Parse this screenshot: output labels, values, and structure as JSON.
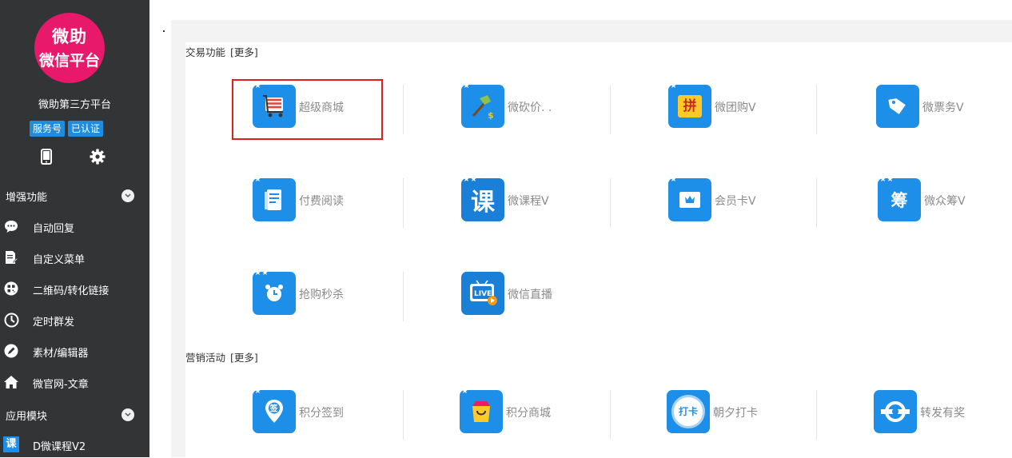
{
  "sidebar": {
    "logo": {
      "line1": "微助",
      "line2": "微信平台"
    },
    "account_name": "微助第三方平台",
    "badges": [
      "服务号",
      "已认证"
    ],
    "tool_icons": [
      "phone-icon",
      "gear-icon"
    ],
    "groups": [
      {
        "title": "增强功能"
      },
      {
        "title": "应用模块"
      }
    ],
    "items": [
      {
        "label": "自动回复",
        "icon": "chat-bubble-icon"
      },
      {
        "label": "自定义菜单",
        "icon": "document-edit-icon"
      },
      {
        "label": "二维码/转化链接",
        "icon": "qrcode-icon"
      },
      {
        "label": "定时群发",
        "icon": "clock-icon"
      },
      {
        "label": "素材/编辑器",
        "icon": "pencil-icon"
      },
      {
        "label": "微官网-文章",
        "icon": "home-icon"
      },
      {
        "label": "D微课程V2",
        "icon": "course-icon"
      }
    ],
    "colors": {
      "background": "#333436",
      "logo": "#e8186a",
      "badge": "#1e8de0"
    }
  },
  "sections": [
    {
      "title": "交易功能",
      "more": "[更多]",
      "tiles": [
        {
          "label": "超级商城",
          "icon": "shopping-cart-icon",
          "selected": true
        },
        {
          "label": "微砍价. .",
          "icon": "bargain-axe-icon"
        },
        {
          "label": "微团购V",
          "icon": "group-buy-icon",
          "glyph": "拼"
        },
        {
          "label": "微票务V",
          "icon": "ticket-tag-icon"
        },
        {
          "label": "付费阅读",
          "icon": "paid-reading-icon"
        },
        {
          "label": "微课程V",
          "icon": "course-icon",
          "glyph": "课"
        },
        {
          "label": "会员卡V",
          "icon": "member-card-icon"
        },
        {
          "label": "微众筹V",
          "icon": "crowdfunding-icon",
          "glyph": "筹"
        },
        {
          "label": "抢购秒杀",
          "icon": "alarm-clock-icon"
        },
        {
          "label": "微信直播",
          "icon": "live-tv-icon",
          "glyph": "LIVE"
        }
      ]
    },
    {
      "title": "营销活动",
      "more": "[更多]",
      "tiles": [
        {
          "label": "积分签到",
          "icon": "checkin-pin-icon",
          "glyph": "签"
        },
        {
          "label": "积分商城",
          "icon": "shopping-bag-icon"
        },
        {
          "label": "朝夕打卡",
          "icon": "punch-card-icon",
          "glyph": "打卡"
        },
        {
          "label": "转发有奖",
          "icon": "share-reward-icon"
        }
      ]
    }
  ],
  "colors": {
    "tile_icon": "#1e8fe8",
    "highlight": "#e01e1e",
    "tile_label": "#8a8a8a"
  }
}
